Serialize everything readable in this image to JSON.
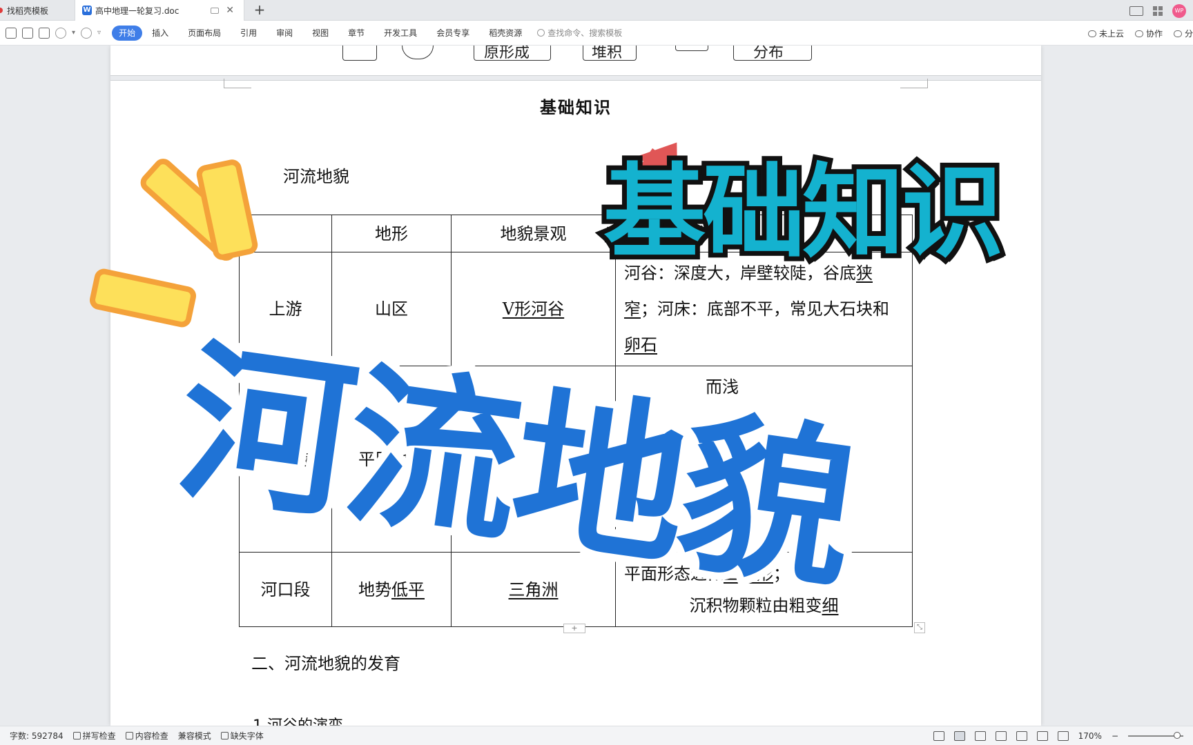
{
  "tabs": [
    {
      "label": "找稻壳模板"
    },
    {
      "label": "高中地理一轮复习.doc"
    }
  ],
  "avatar_text": "WP",
  "ribbon": {
    "menus": [
      "开始",
      "插入",
      "页面布局",
      "引用",
      "审阅",
      "视图",
      "章节",
      "开发工具",
      "会员专享",
      "稻壳资源"
    ],
    "search_placeholder": "查找命令、搜索模板",
    "right": [
      "未上云",
      "协作",
      "分"
    ]
  },
  "prev_page_fragments": [
    "原形成",
    "堆积",
    "分布"
  ],
  "document": {
    "heading": "基础知识",
    "section1": "河流地貌",
    "table": {
      "headers": [
        "",
        "地形",
        "地貌景观",
        ""
      ],
      "rows": [
        {
          "segment": "上游",
          "terrain": "山区",
          "landscape": "V形河谷",
          "feature_parts": [
            "河谷：深度大，岸壁较陡，谷底",
            "狭窄",
            "；河床：底部不平，常见大石块和",
            "卵石"
          ]
        },
        {
          "segment": "中下游",
          "terrain": "平原地区",
          "landscape": "",
          "feature_parts": [
            "",
            "",
            "而浅",
            ""
          ]
        },
        {
          "segment": "河口段",
          "terrain_parts": [
            "地势",
            "低平"
          ],
          "landscape": "三角洲",
          "feature_parts": [
            "平面形态近似",
            "三角形",
            "；",
            "沉积物颗粒由粗变",
            "细"
          ]
        }
      ]
    },
    "section2": "二、河流地貌的发育",
    "section3": "1.河谷的演变"
  },
  "overlay": {
    "keyword": "基础知识",
    "title": "河流地貌"
  },
  "statusbar": {
    "word_count": "字数: 592784",
    "spell": "拼写检查",
    "content": "内容检查",
    "compat": "兼容模式",
    "missing_font": "缺失字体",
    "zoom": "170%"
  },
  "colors": {
    "accent": "#3f7ee8",
    "keyword_fill": "#14b2cf",
    "title_fill": "#1f73d6",
    "burst_fill": "#fde05a",
    "burst_outline": "#f4a23a",
    "cursor": "#e05656"
  }
}
